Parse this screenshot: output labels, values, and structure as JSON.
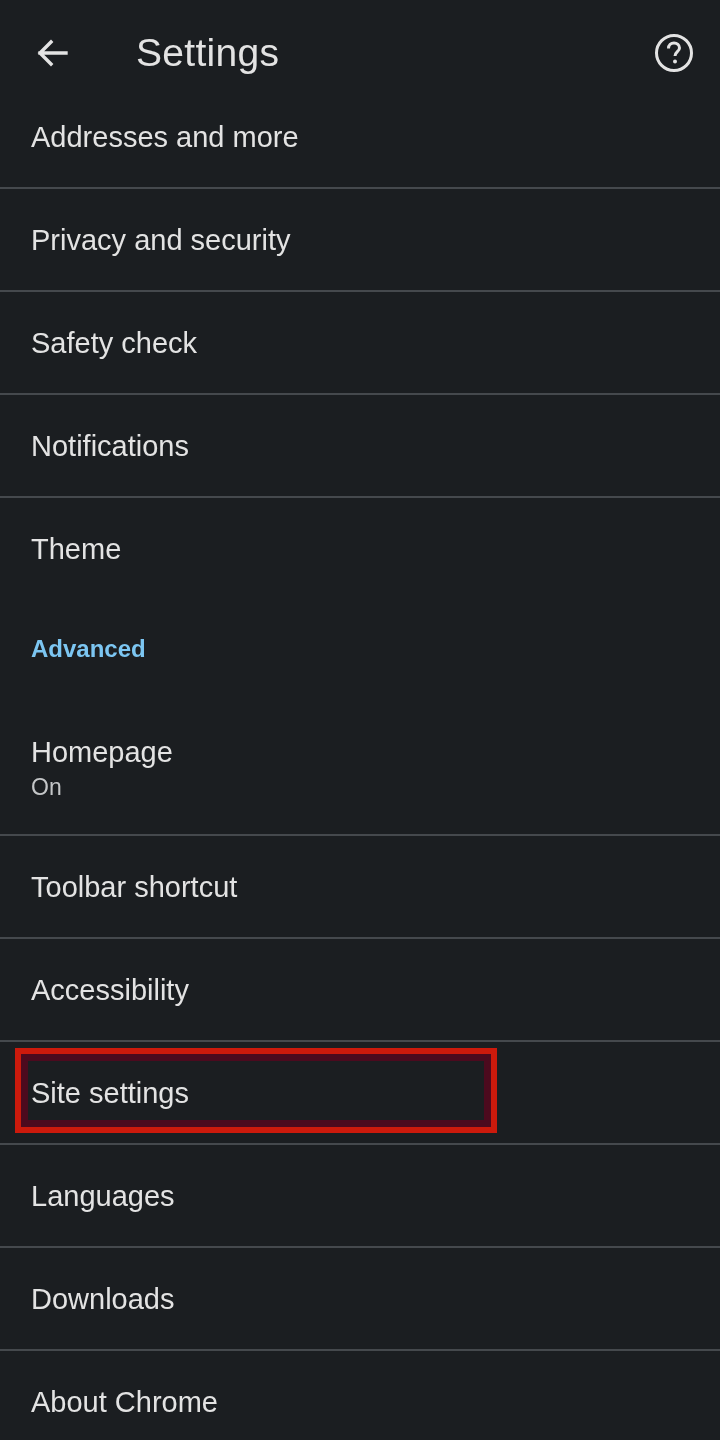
{
  "app_bar": {
    "title": "Settings"
  },
  "items": [
    {
      "kind": "item",
      "title": "Addresses and more",
      "highlighted": false
    },
    {
      "kind": "item",
      "title": "Privacy and security",
      "highlighted": false
    },
    {
      "kind": "item",
      "title": "Safety check",
      "highlighted": false
    },
    {
      "kind": "item",
      "title": "Notifications",
      "highlighted": false
    },
    {
      "kind": "item",
      "title": "Theme",
      "highlighted": false
    },
    {
      "kind": "section",
      "title": "Advanced"
    },
    {
      "kind": "item",
      "title": "Homepage",
      "subtitle": "On",
      "highlighted": false
    },
    {
      "kind": "item",
      "title": "Toolbar shortcut",
      "highlighted": false
    },
    {
      "kind": "item",
      "title": "Accessibility",
      "highlighted": false
    },
    {
      "kind": "item",
      "title": "Site settings",
      "highlighted": true
    },
    {
      "kind": "item",
      "title": "Languages",
      "highlighted": false
    },
    {
      "kind": "item",
      "title": "Downloads",
      "highlighted": false
    },
    {
      "kind": "item",
      "title": "About Chrome",
      "highlighted": false
    }
  ]
}
